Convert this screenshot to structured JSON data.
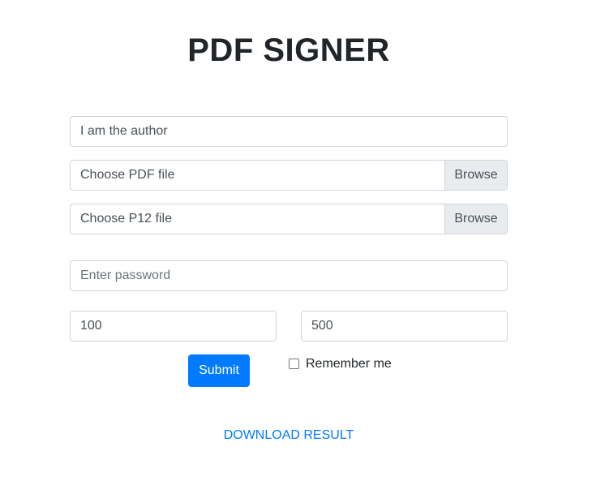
{
  "title": "PDF SIGNER",
  "form": {
    "author_value": "I am the author",
    "pdf_file_label": "Choose PDF file",
    "p12_file_label": "Choose P12 file",
    "browse_label": "Browse",
    "password_placeholder": "Enter password",
    "x_value": "100",
    "y_value": "500",
    "submit_label": "Submit",
    "remember_label": "Remember me",
    "remember_checked": false
  },
  "download_label": "DOWNLOAD RESULT",
  "colors": {
    "accent": "#007bff",
    "border": "#ced4da",
    "browse_bg": "#e9ecef",
    "text": "#212529"
  }
}
